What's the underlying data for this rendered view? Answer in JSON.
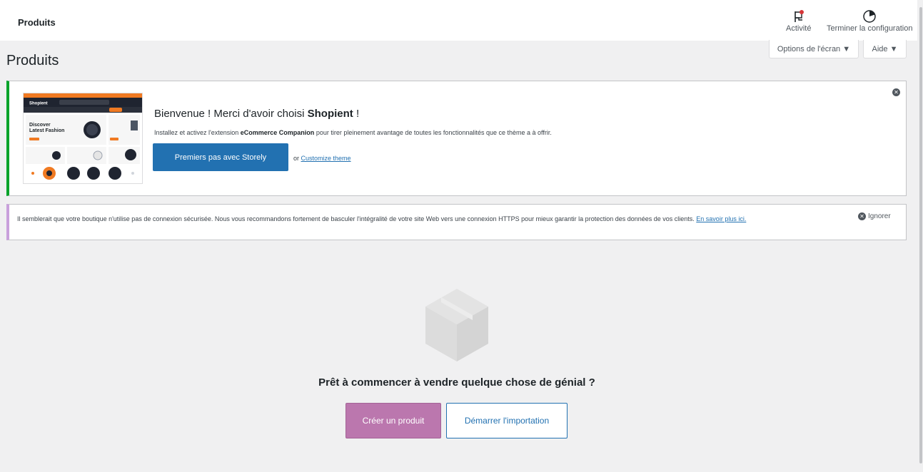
{
  "topbar": {
    "title": "Produits",
    "activity_label": "Activité",
    "finish_label": "Terminer la configuration"
  },
  "screen_options": {
    "options_label": "Options de l'écran ▼",
    "help_label": "Aide ▼"
  },
  "page": {
    "heading": "Produits"
  },
  "welcome": {
    "title_prefix": "Bienvenue ! Merci d'avoir choisi ",
    "theme_name": "Shopient",
    "title_suffix": " !",
    "desc_prefix": "Installez et activez l'extension ",
    "extension_name": "eCommerce Companion",
    "desc_suffix": " pour tirer pleinement avantage de toutes les fonctionnalités que ce thème a à offrir.",
    "primary_button": "Premiers pas avec Storely",
    "or_text": "or ",
    "customize_link": "Customize theme",
    "thumb_logo": "Shopient",
    "thumb_headline1": "Discover",
    "thumb_headline2": "Latest Fashion"
  },
  "https_notice": {
    "text": "Il semblerait que votre boutique n'utilise pas de connexion sécurisée. Nous vous recommandons fortement de basculer l'intégralité de votre site Web vers une connexion HTTPS pour mieux garantir la protection des données de vos clients. ",
    "link": "En savoir plus ici.",
    "ignore_label": "Ignorer"
  },
  "empty_state": {
    "title": "Prêt à commencer à vendre quelque chose de génial ?",
    "create_button": "Créer un produit",
    "import_button": "Démarrer l'importation"
  },
  "colors": {
    "wp_blue": "#2271b1",
    "woo_purple": "#bb77ae",
    "success_green": "#00a32a",
    "notice_purple": "#c9a0dc",
    "accent_orange": "#f07a22"
  }
}
